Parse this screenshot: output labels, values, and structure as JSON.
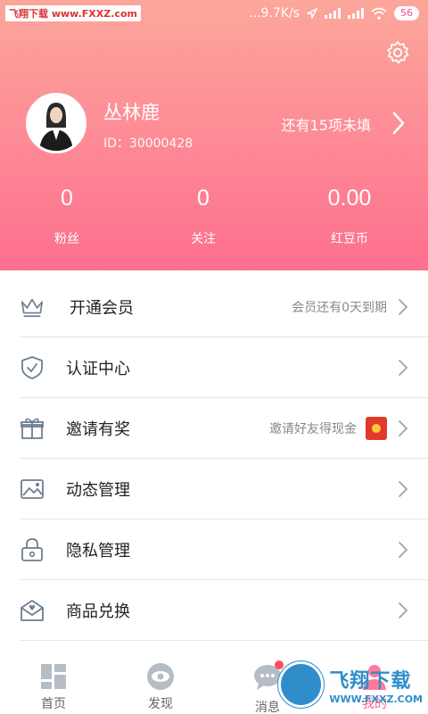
{
  "statusbar": {
    "watermark": "飞翔下载 www.FXXZ.com",
    "speed": "...9.7K/s",
    "battery": "56"
  },
  "profile": {
    "name": "丛林鹿",
    "id_text": "ID：30000428",
    "incomplete_text": "还有15项未填"
  },
  "stats": [
    {
      "value": "0",
      "label": "粉丝"
    },
    {
      "value": "0",
      "label": "关注"
    },
    {
      "value": "0.00",
      "label": "红豆币"
    }
  ],
  "menu": [
    {
      "label": "开通会员",
      "hint": "会员还有0天到期",
      "icon": "crown-icon"
    },
    {
      "label": "认证中心",
      "hint": "",
      "icon": "shield-check-icon"
    },
    {
      "label": "邀请有奖",
      "hint": "邀请好友得现金",
      "icon": "gift-icon"
    },
    {
      "label": "动态管理",
      "hint": "",
      "icon": "image-icon"
    },
    {
      "label": "隐私管理",
      "hint": "",
      "icon": "lock-icon"
    },
    {
      "label": "商品兑换",
      "hint": "",
      "icon": "mail-heart-icon"
    }
  ],
  "tabbar": [
    {
      "label": "首页",
      "icon": "grid-icon"
    },
    {
      "label": "发现",
      "icon": "eye-icon"
    },
    {
      "label": "消息",
      "icon": "chat-icon"
    },
    {
      "label": "我的",
      "icon": "user-icon"
    }
  ],
  "footer_watermark": {
    "title": "飞翔下载",
    "url": "WWW.FXXZ.COM"
  }
}
